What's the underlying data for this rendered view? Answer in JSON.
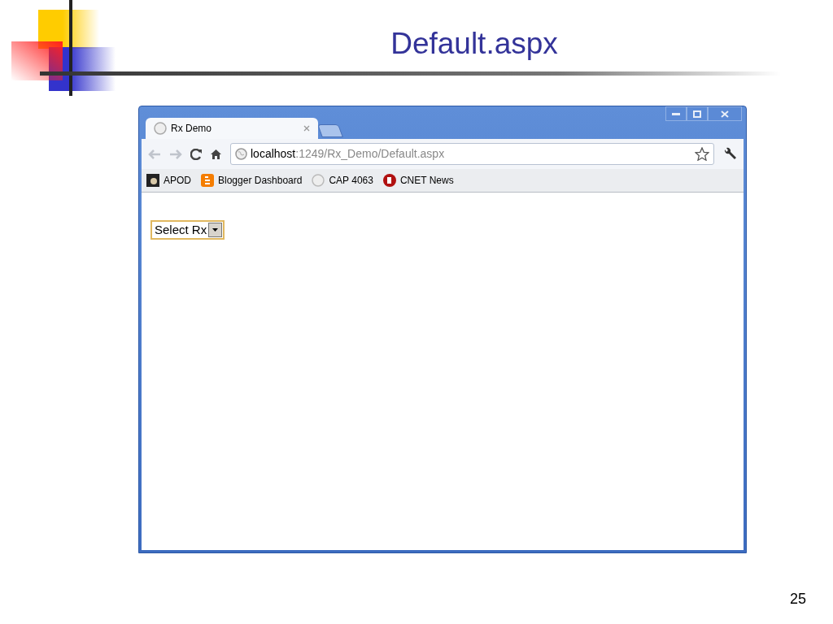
{
  "slide": {
    "title": "Default.aspx",
    "number": "25"
  },
  "browser": {
    "tabs": [
      {
        "title": "Rx Demo",
        "selected": true
      }
    ],
    "address": {
      "host": "localhost",
      "rest": ":1249/Rx_Demo/Default.aspx"
    },
    "bookmarks": [
      {
        "label": "APOD",
        "kind": "photo"
      },
      {
        "label": "Blogger Dashboard",
        "kind": "blogger"
      },
      {
        "label": "CAP 4063",
        "kind": "globe"
      },
      {
        "label": "CNET News",
        "kind": "cnet"
      }
    ],
    "page": {
      "dropdown": {
        "value": "Select Rx"
      }
    }
  }
}
